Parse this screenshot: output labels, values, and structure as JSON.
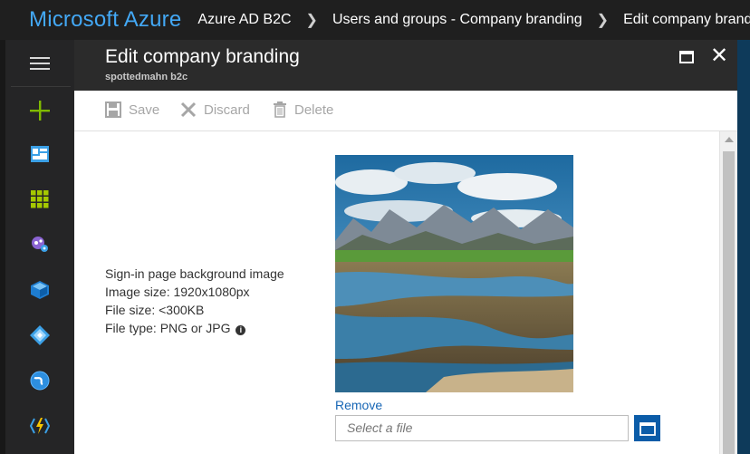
{
  "topbar": {
    "brand": "Microsoft Azure",
    "breadcrumbs": [
      "Azure AD B2C",
      "Users and groups - Company branding",
      "Edit company branding"
    ]
  },
  "nav": {
    "items": [
      "menu-icon",
      "create-icon",
      "dashboard-icon",
      "all-services-icon",
      "resource-groups-icon",
      "cube-icon",
      "diamond-icon",
      "globe-icon",
      "function-icon"
    ]
  },
  "blade": {
    "title": "Edit company branding",
    "subtitle": "spottedmahn b2c",
    "toolbar": {
      "save": "Save",
      "discard": "Discard",
      "delete": "Delete"
    },
    "info": {
      "line1": "Sign-in page background image",
      "line2": "Image size: 1920x1080px",
      "line3": "File size: <300KB",
      "line4": "File type: PNG or JPG"
    },
    "remove_link": "Remove",
    "file_placeholder": "Select a file"
  },
  "colors": {
    "brand_blue": "#43a8f5",
    "accent_button": "#0b5ca8",
    "link": "#1766b5"
  }
}
